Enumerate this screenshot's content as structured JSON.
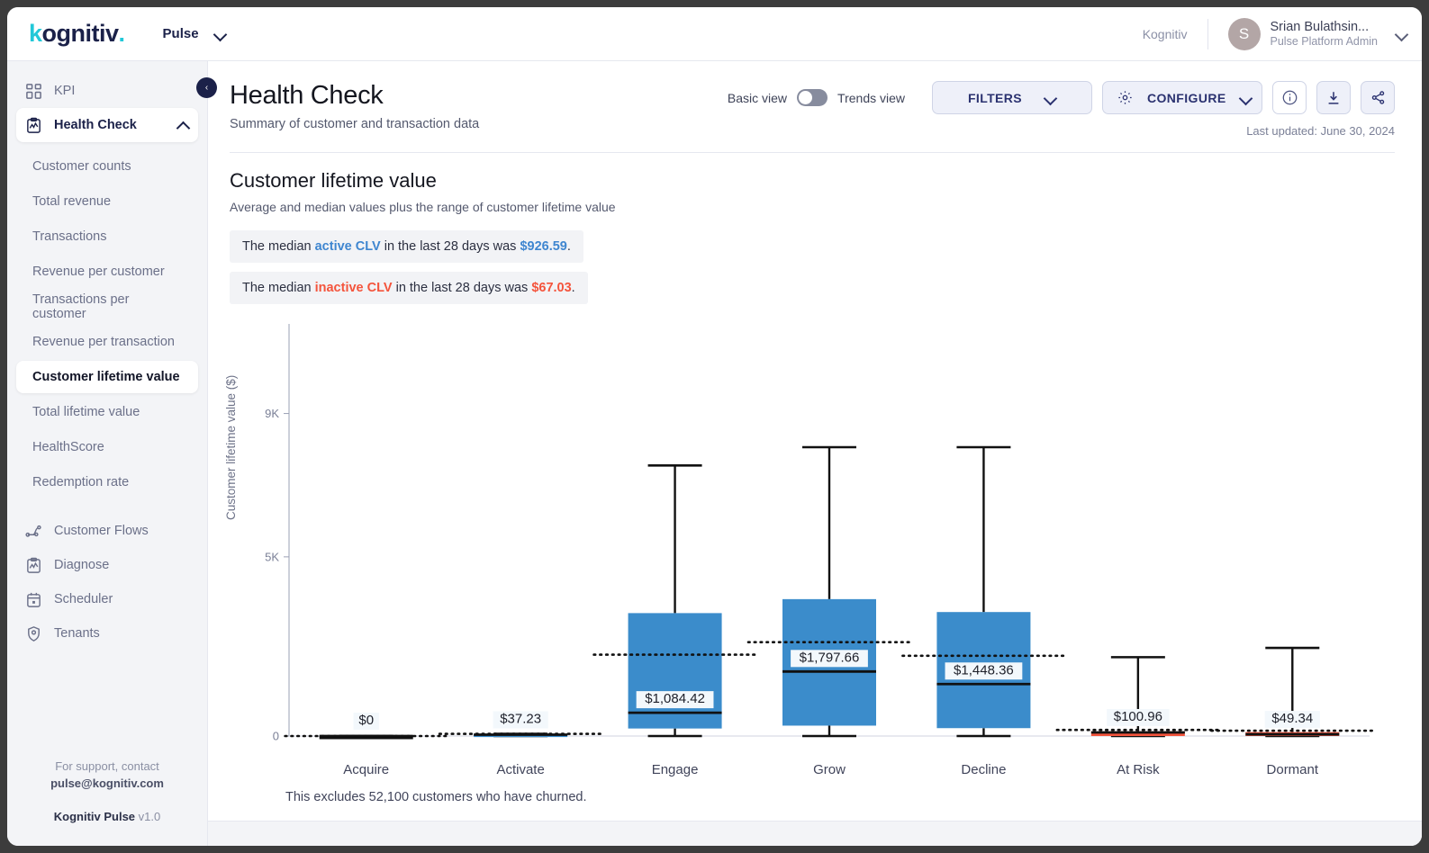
{
  "topbar": {
    "logo_main": "ognitiv",
    "logo_k": "k",
    "logo_dot": ".",
    "product": "Pulse",
    "tenant": "Kognitiv",
    "user_initial": "S",
    "user_name": "Srian Bulathsin...",
    "user_role": "Pulse Platform Admin"
  },
  "sidebar": {
    "top_items": [
      {
        "label": "KPI",
        "icon": "grid-icon",
        "active": false
      }
    ],
    "section": {
      "label": "Health Check",
      "icon": "clipboard-chart-icon",
      "active": true
    },
    "sub_items": [
      {
        "label": "Customer counts",
        "active": false
      },
      {
        "label": "Total revenue",
        "active": false
      },
      {
        "label": "Transactions",
        "active": false
      },
      {
        "label": "Revenue per customer",
        "active": false
      },
      {
        "label": "Transactions per customer",
        "active": false
      },
      {
        "label": "Revenue per transaction",
        "active": false
      },
      {
        "label": "Customer lifetime value",
        "active": true
      },
      {
        "label": "Total lifetime value",
        "active": false
      },
      {
        "label": "HealthScore",
        "active": false
      },
      {
        "label": "Redemption rate",
        "active": false
      }
    ],
    "bottom_items": [
      {
        "label": "Customer Flows",
        "icon": "flow-icon"
      },
      {
        "label": "Diagnose",
        "icon": "clipboard-chart-icon"
      },
      {
        "label": "Scheduler",
        "icon": "calendar-icon"
      },
      {
        "label": "Tenants",
        "icon": "shield-user-icon"
      }
    ],
    "footer": {
      "support_line": "For support, contact",
      "support_email": "pulse@kognitiv.com",
      "app_name": "Kognitiv Pulse",
      "version": "v1.0"
    },
    "collapse_label": "‹"
  },
  "header": {
    "title": "Health Check",
    "subtitle": "Summary of customer and transaction data",
    "toggle_left": "Basic view",
    "toggle_right": "Trends view",
    "filters_label": "FILTERS",
    "configure_label": "CONFIGURE",
    "last_updated": "Last updated: June 30, 2024"
  },
  "section": {
    "title": "Customer lifetime value",
    "subtitle": "Average and median values plus the range of customer lifetime value",
    "callouts": [
      {
        "pre": "The median ",
        "highlight": "active CLV",
        "highlight_color": "blue",
        "mid": " in the last 28 days was ",
        "value": "$926.59",
        "post": "."
      },
      {
        "pre": "The median ",
        "highlight": "inactive CLV",
        "highlight_color": "red",
        "mid": " in the last 28 days was ",
        "value": "$67.03",
        "post": "."
      }
    ],
    "footnote": "This excludes 52,100 customers who have churned."
  },
  "colors": {
    "active_blue": "#3f86d0",
    "inactive_red": "#f4543c",
    "box_blue": "#3b8ccb",
    "box_red": "#f4543c",
    "accent_navy": "#1b2149",
    "teal": "#22c8d8"
  },
  "chart_data": {
    "type": "boxplot",
    "title": "Customer lifetime value",
    "xlabel": "",
    "ylabel": "Customer lifetime value ($)",
    "ylim": [
      0,
      11500
    ],
    "yticks": [
      0,
      5000,
      9000
    ],
    "ytick_labels": [
      "0",
      "5K",
      "9K"
    ],
    "grid": false,
    "legend": "none",
    "categories": [
      "Acquire",
      "Activate",
      "Engage",
      "Grow",
      "Decline",
      "At Risk",
      "Dormant"
    ],
    "boxes": [
      {
        "category": "Acquire",
        "color": "#101010",
        "q1": 0,
        "q3": 0,
        "median": 0,
        "mean": 0,
        "whisker_low": 0,
        "whisker_high": 0,
        "label": "$0"
      },
      {
        "category": "Activate",
        "color": "#3b8ccb",
        "q1": 0,
        "q3": 60,
        "median": 37.23,
        "mean": 60,
        "whisker_low": 0,
        "whisker_high": 60,
        "label": "$37.23"
      },
      {
        "category": "Engage",
        "color": "#3b8ccb",
        "q1": 210,
        "q3": 3430,
        "median": 650,
        "mean": 2270,
        "whisker_low": 0,
        "whisker_high": 7550,
        "label": "$1,084.42"
      },
      {
        "category": "Grow",
        "color": "#3b8ccb",
        "q1": 290,
        "q3": 3820,
        "median": 1800,
        "mean": 2620,
        "whisker_low": 0,
        "whisker_high": 8060,
        "label": "$1,797.66"
      },
      {
        "category": "Decline",
        "color": "#3b8ccb",
        "q1": 220,
        "q3": 3460,
        "median": 1450,
        "mean": 2240,
        "whisker_low": 0,
        "whisker_high": 8060,
        "label": "$1,448.36"
      },
      {
        "category": "At Risk",
        "color": "#f4543c",
        "q1": 0,
        "q3": 130,
        "median": 101,
        "mean": 170,
        "whisker_low": 0,
        "whisker_high": 2200,
        "label": "$100.96"
      },
      {
        "category": "Dormant",
        "color": "#f4543c",
        "q1": 0,
        "q3": 110,
        "median": 49,
        "mean": 150,
        "whisker_low": 0,
        "whisker_high": 2460,
        "label": "$49.34"
      }
    ]
  }
}
